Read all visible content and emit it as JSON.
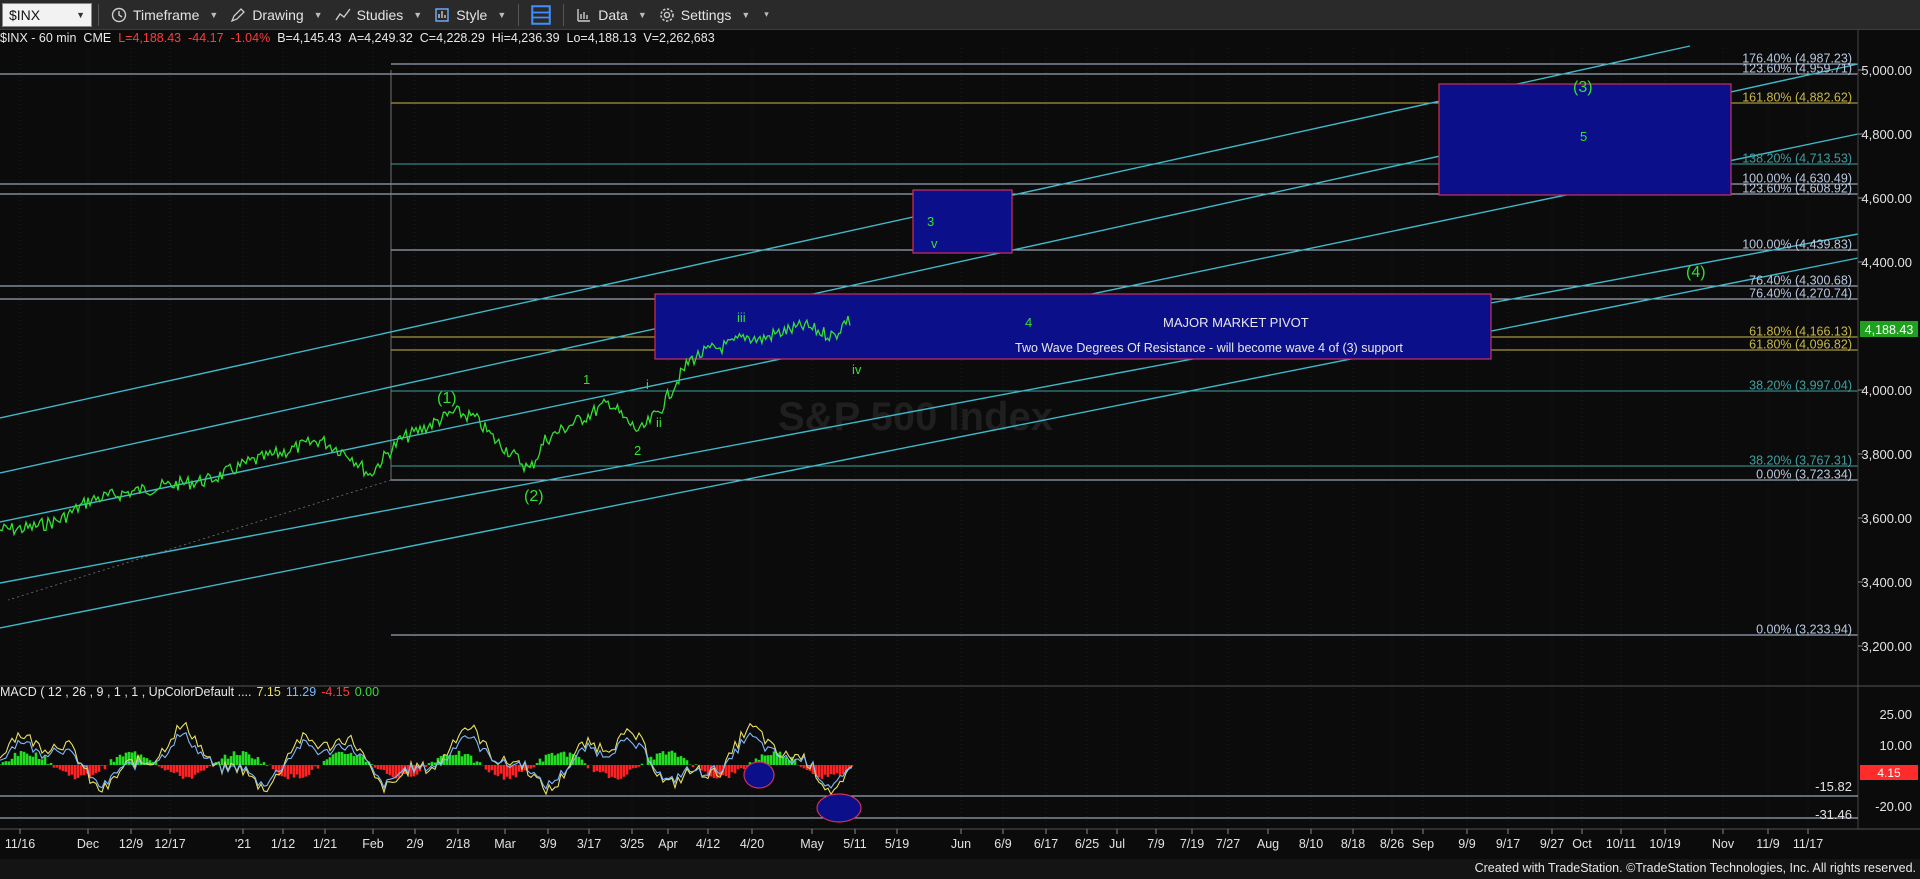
{
  "toolbar": {
    "symbol": "$INX",
    "timeframe": "Timeframe",
    "drawing": "Drawing",
    "studies": "Studies",
    "style": "Style",
    "data": "Data",
    "settings": "Settings"
  },
  "infobar": {
    "name": "$INX - 60 min",
    "exchange": "CME",
    "last": "L=4,188.43",
    "change": "-44.17",
    "pct": "-1.04%",
    "bid": "B=4,145.43",
    "ask": "A=4,249.32",
    "close": "C=4,228.29",
    "high": "Hi=4,236.39",
    "low": "Lo=4,188.13",
    "volume": "V=2,262,683"
  },
  "watermark": "S&P 500 Index",
  "price_axis": [
    "5,000.00",
    "4,800.00",
    "4,600.00",
    "4,400.00",
    "4,000.00",
    "3,800.00",
    "3,600.00",
    "3,400.00",
    "3,200.00"
  ],
  "last_price_tag": "4,188.43",
  "macd": {
    "title": "MACD ( 12 , 26 , 9 , 1 , 1 , UpColorDefault ....",
    "v1": "7.15",
    "v2": "11.29",
    "v3": "-4.15",
    "v4": "0.00",
    "axis": [
      "25.00",
      "10.00",
      "-20.00"
    ],
    "levels": [
      "-15.82",
      "-31.46"
    ],
    "tag": "4.15"
  },
  "fib_levels": [
    {
      "text": "176.40% (4,987.23)",
      "color": "#b8c8e0"
    },
    {
      "text": "123.60% (4,959.71)",
      "color": "#b8c8e0"
    },
    {
      "text": "161.80% (4,882.62)",
      "color": "#c8b84a"
    },
    {
      "text": "138.20% (4,713.53)",
      "color": "#3fa0a0"
    },
    {
      "text": "100.00% (4,630.49)",
      "color": "#b8c8e0"
    },
    {
      "text": "123.60% (4,608.92)",
      "color": "#b8c8e0"
    },
    {
      "text": "100.00% (4,439.83)",
      "color": "#b8c8e0"
    },
    {
      "text": "76.40% (4,300.68)",
      "color": "#b8c8e0"
    },
    {
      "text": "76.40% (4,270.74)",
      "color": "#b8c8e0"
    },
    {
      "text": "61.80% (4,166.13)",
      "color": "#c8b84a"
    },
    {
      "text": "61.80% (4,096.82)",
      "color": "#c8b84a"
    },
    {
      "text": "38.20% (3,997.04)",
      "color": "#3fa0a0"
    },
    {
      "text": "38.20% (3,767.31)",
      "color": "#3fa0a0"
    },
    {
      "text": "0.00% (3,723.34)",
      "color": "#b8c8e0"
    },
    {
      "text": "0.00% (3,233.94)",
      "color": "#b8c8e0"
    }
  ],
  "annotations": {
    "pivot": "MAJOR MARKET PIVOT",
    "resistance": "Two Wave Degrees Of Resistance - will become wave 4 of (3) support",
    "wave_1p": "(1)",
    "wave_2p": "(2)",
    "wave_3p": "(3)",
    "wave_4p": "(4)",
    "wave_1": "1",
    "wave_2": "2",
    "wave_3": "3",
    "wave_4": "4",
    "wave_5": "5",
    "wave_i": "i",
    "wave_ii": "ii",
    "wave_iii": "iii",
    "wave_iv": "iv",
    "wave_v": "v"
  },
  "dates": [
    "11/16",
    "Dec",
    "12/9",
    "12/17",
    "'21",
    "1/12",
    "1/21",
    "Feb",
    "2/9",
    "2/18",
    "Mar",
    "3/9",
    "3/17",
    "3/25",
    "Apr",
    "4/12",
    "4/20",
    "May",
    "5/11",
    "5/19",
    "Jun",
    "6/9",
    "6/17",
    "6/25",
    "Jul",
    "7/9",
    "7/19",
    "7/27",
    "Aug",
    "8/10",
    "8/18",
    "8/26",
    "Sep",
    "9/9",
    "9/17",
    "9/27",
    "Oct",
    "10/11",
    "10/19",
    "Nov",
    "11/9",
    "11/17"
  ],
  "footer": "Created with TradeStation. ©TradeStation Technologies, Inc. All rights reserved."
}
